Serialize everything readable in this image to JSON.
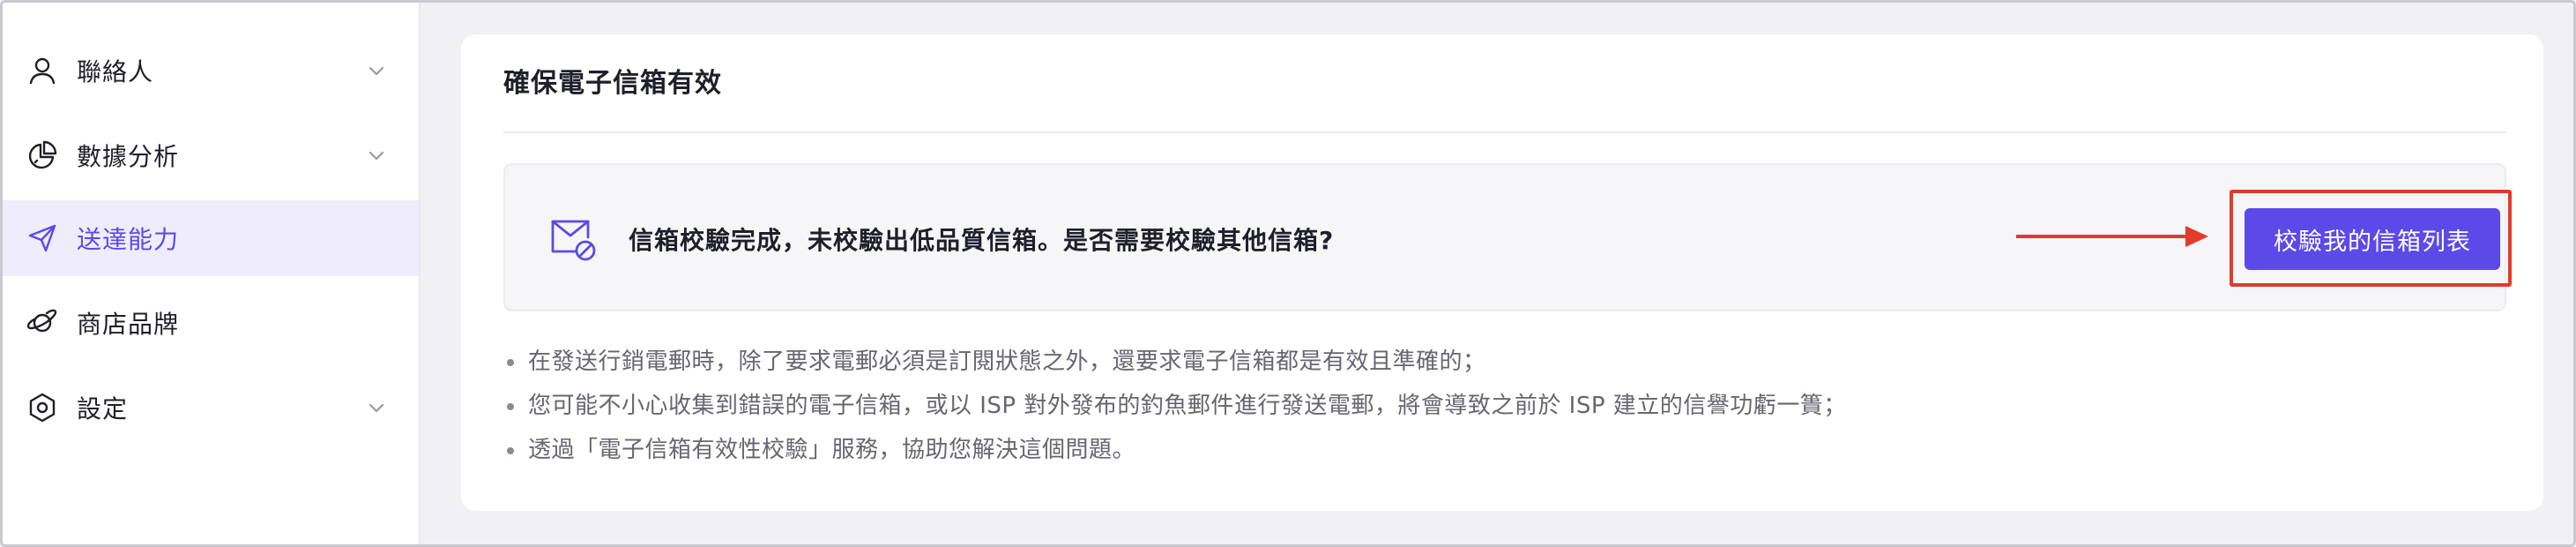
{
  "sidebar": {
    "items": [
      {
        "label": "聯絡人",
        "icon": "user-icon",
        "has_chevron": true,
        "active": false
      },
      {
        "label": "數據分析",
        "icon": "pie-chart-icon",
        "has_chevron": true,
        "active": false
      },
      {
        "label": "送達能力",
        "icon": "send-icon",
        "has_chevron": false,
        "active": true
      },
      {
        "label": "商店品牌",
        "icon": "planet-icon",
        "has_chevron": false,
        "active": false
      },
      {
        "label": "設定",
        "icon": "settings-icon",
        "has_chevron": true,
        "active": false
      }
    ]
  },
  "main": {
    "title": "確保電子信箱有效",
    "notice": {
      "icon": "mail-blocked-icon",
      "text": "信箱校驗完成，未校驗出低品質信箱。是否需要校驗其他信箱?",
      "button_label": "校驗我的信箱列表"
    },
    "tips": [
      "在發送行銷電郵時，除了要求電郵必須是訂閱狀態之外，還要求電子信箱都是有效且準確的；",
      "您可能不小心收集到錯誤的電子信箱，或以 ISP 對外發布的釣魚郵件進行發送電郵，將會導致之前於 ISP 建立的信譽功虧一簣；",
      "透過「電子信箱有效性校驗」服務，協助您解決這個問題。"
    ]
  },
  "colors": {
    "accent": "#5b4ae8",
    "active_bg": "#efedfb",
    "annotation": "#e23b2a",
    "page_bg": "#f1f1f5"
  }
}
